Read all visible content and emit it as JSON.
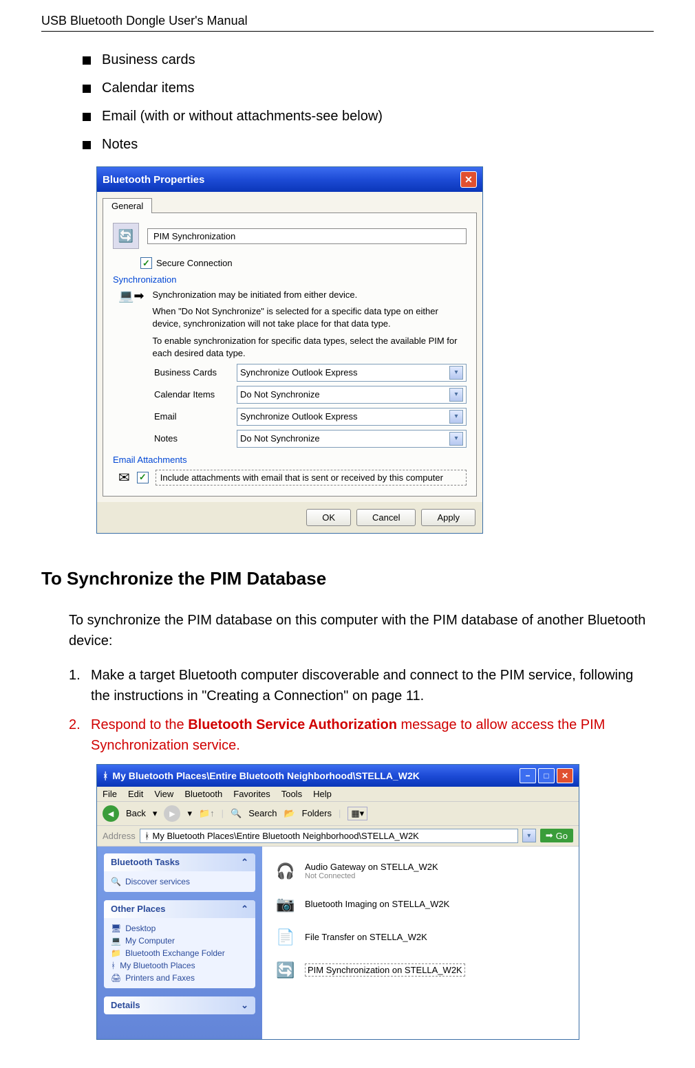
{
  "header": "USB Bluetooth Dongle User's Manual",
  "bullets": {
    "b1": "Business cards",
    "b2": "Calendar items",
    "b3": "Email (with or without attachments-see below)",
    "b4": "Notes"
  },
  "dialog": {
    "title": "Bluetooth Properties",
    "tab": "General",
    "serviceName": "PIM Synchronization",
    "secureConnection": "Secure Connection",
    "syncLabel": "Synchronization",
    "desc1": "Synchronization may be initiated from either device.",
    "desc2": "When \"Do Not Synchronize\" is selected for a specific data type on either device, synchronization will not take place for that data type.",
    "desc3": "To enable synchronization for specific data types, select the available PIM for each desired data type.",
    "rows": {
      "businessCards": {
        "label": "Business Cards",
        "value": "Synchronize Outlook Express"
      },
      "calendarItems": {
        "label": "Calendar Items",
        "value": "Do Not Synchronize"
      },
      "email": {
        "label": "Email",
        "value": "Synchronize Outlook Express"
      },
      "notes": {
        "label": "Notes",
        "value": "Do Not Synchronize"
      }
    },
    "emailAttachLabel": "Email Attachments",
    "emailAttachText": "Include attachments with email that is sent or received by this computer",
    "buttons": {
      "ok": "OK",
      "cancel": "Cancel",
      "apply": "Apply"
    }
  },
  "section": {
    "heading": "To Synchronize the PIM Database",
    "intro": "To synchronize the PIM database on this computer with the PIM database of another Bluetooth device:",
    "step1": "Make a target Bluetooth computer discoverable and connect to the PIM service, following the instructions in \"Creating a Connection\" on page 11.",
    "step2a": "Respond to the ",
    "step2b": "Bluetooth Service Authorization",
    "step2c": " message to allow access the PIM Synchronization service."
  },
  "explorer": {
    "title": "My Bluetooth Places\\Entire Bluetooth Neighborhood\\STELLA_W2K",
    "menu": {
      "file": "File",
      "edit": "Edit",
      "view": "View",
      "bluetooth": "Bluetooth",
      "favorites": "Favorites",
      "tools": "Tools",
      "help": "Help"
    },
    "toolbar": {
      "back": "Back",
      "search": "Search",
      "folders": "Folders"
    },
    "addressLabel": "Address",
    "addressValue": "My Bluetooth Places\\Entire Bluetooth Neighborhood\\STELLA_W2K",
    "go": "Go",
    "sidebar": {
      "tasks": {
        "title": "Bluetooth Tasks",
        "discover": "Discover services"
      },
      "other": {
        "title": "Other Places",
        "desktop": "Desktop",
        "myComputer": "My Computer",
        "btExchange": "Bluetooth Exchange Folder",
        "btPlaces": "My Bluetooth Places",
        "printers": "Printers and Faxes"
      },
      "details": {
        "title": "Details"
      }
    },
    "services": {
      "audio": {
        "name": "Audio Gateway on STELLA_W2K",
        "status": "Not Connected"
      },
      "imaging": {
        "name": "Bluetooth Imaging on STELLA_W2K"
      },
      "fileTransfer": {
        "name": "File Transfer on STELLA_W2K"
      },
      "pimSync": {
        "name": "PIM Synchronization on STELLA_W2K"
      }
    }
  }
}
